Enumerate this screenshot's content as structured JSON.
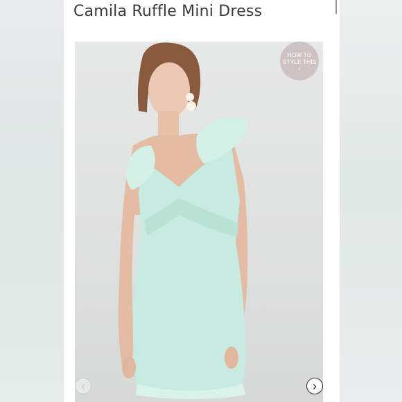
{
  "product": {
    "title": "Camila Ruffle Mini Dress",
    "dress_color": "#c7ebe0"
  },
  "badge": {
    "line1": "HOW TO",
    "line2": "STYLE THIS",
    "arrow": "↓"
  },
  "gallery": {
    "prev_icon": "‹",
    "next_icon": "›",
    "photo_alt": "Model wearing mint ruffle mini dress"
  }
}
